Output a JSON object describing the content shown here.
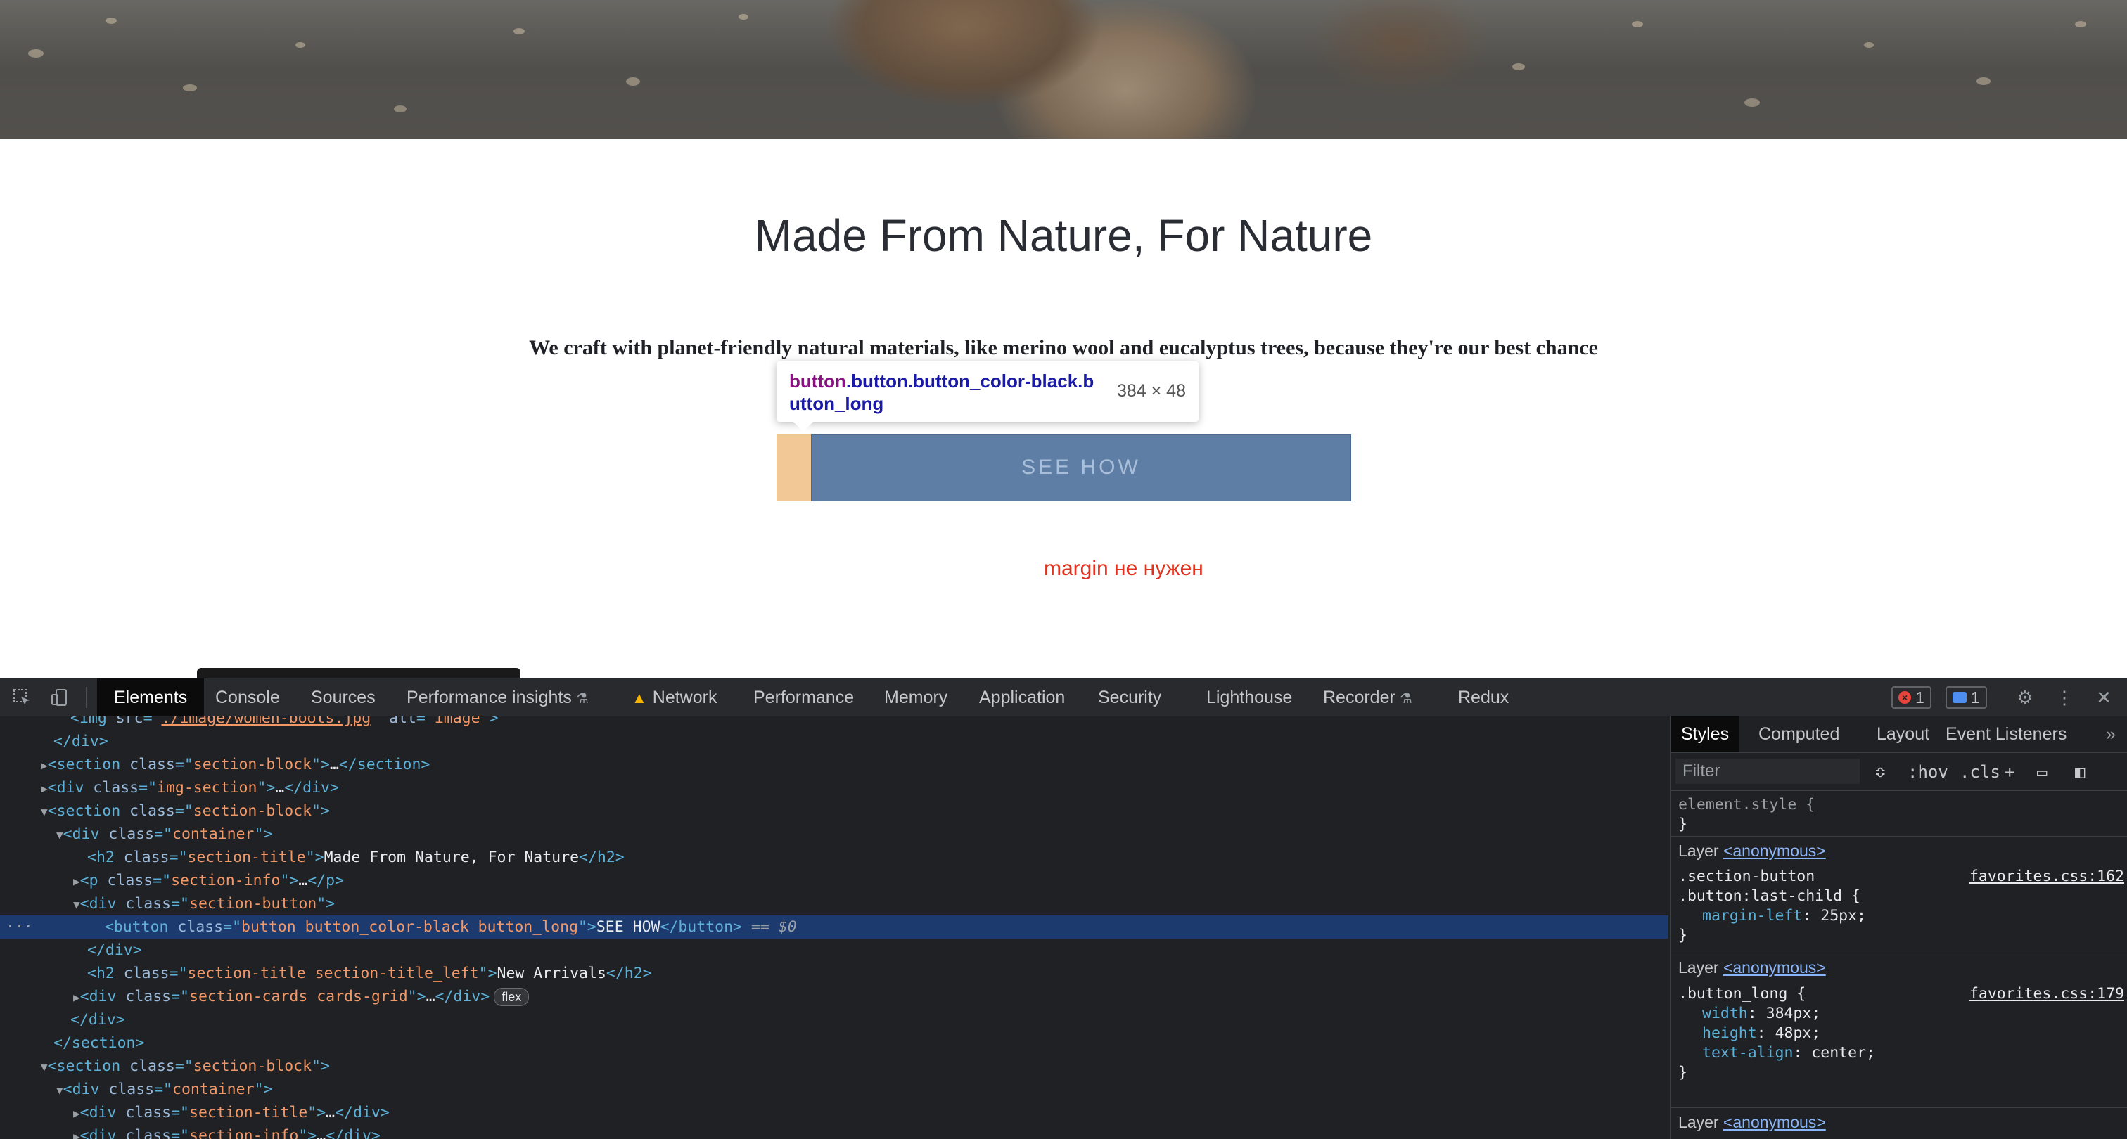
{
  "page": {
    "title": "Made From Nature, For Nature",
    "info": "We craft with planet-friendly natural materials, like merino wool and eucalyptus trees, because they're our best chance",
    "button_label": "SEE HOW",
    "annotation": "margin не нужен"
  },
  "inspect_tooltip": {
    "tag": "button",
    "classes": ".button.button_color-black.button_long",
    "size": "384 × 48"
  },
  "devtools": {
    "tabs": [
      "Elements",
      "Console",
      "Sources",
      "Performance insights",
      "Network",
      "Performance",
      "Memory",
      "Application",
      "Security",
      "Lighthouse",
      "Recorder",
      "Redux"
    ],
    "errors_count": "1",
    "messages_count": "1",
    "dom_lines": [
      {
        "text": "<img src=\"./image/women-boots.jpg\" alt=\"image\">"
      },
      {
        "text": "</div>"
      },
      {
        "text": "<section class=\"section-block\">…</section>"
      },
      {
        "text": "<div class=\"img-section\">…</div>"
      },
      {
        "text": "<section class=\"section-block\">"
      },
      {
        "text": "<div class=\"container\">"
      },
      {
        "text": "<h2 class=\"section-title\">Made From Nature, For Nature</h2>"
      },
      {
        "text": "<p class=\"section-info\">…</p>"
      },
      {
        "text": "<div class=\"section-button\">"
      },
      {
        "text": "<button class=\"button button_color-black button_long\">SEE HOW</button> == $0"
      },
      {
        "text": "</div>"
      },
      {
        "text": "<h2 class=\"section-title section-title_left\">New Arrivals</h2>"
      },
      {
        "text": "<div class=\"section-cards cards-grid\">…</div>"
      },
      {
        "text": "</div>"
      },
      {
        "text": "</section>"
      },
      {
        "text": "<section class=\"section-block\">"
      },
      {
        "text": "<div class=\"container\">"
      },
      {
        "text": "<div class=\"section-title\">…</div>"
      },
      {
        "text": "<div class=\"section-info\">…</div>"
      }
    ],
    "flex_badge": "flex",
    "styles_tabs": [
      "Styles",
      "Computed",
      "Layout",
      "Event Listeners"
    ],
    "filter_placeholder": "Filter",
    "hov": ":hov",
    "cls": ".cls",
    "element_style": "element.style {",
    "close_brace": "}",
    "layer_label": "Layer",
    "layer_name": "<anonymous>",
    "rule1": {
      "selector_1": ".section-button",
      "selector_2": ".button:last-child {",
      "source": "favorites.css:162",
      "props": [
        {
          "name": "margin-left",
          "value": "25px;"
        }
      ]
    },
    "rule2": {
      "selector": ".button_long {",
      "source": "favorites.css:179",
      "props": [
        {
          "name": "width",
          "value": "384px;"
        },
        {
          "name": "height",
          "value": "48px;"
        },
        {
          "name": "text-align",
          "value": "center;"
        }
      ]
    }
  }
}
